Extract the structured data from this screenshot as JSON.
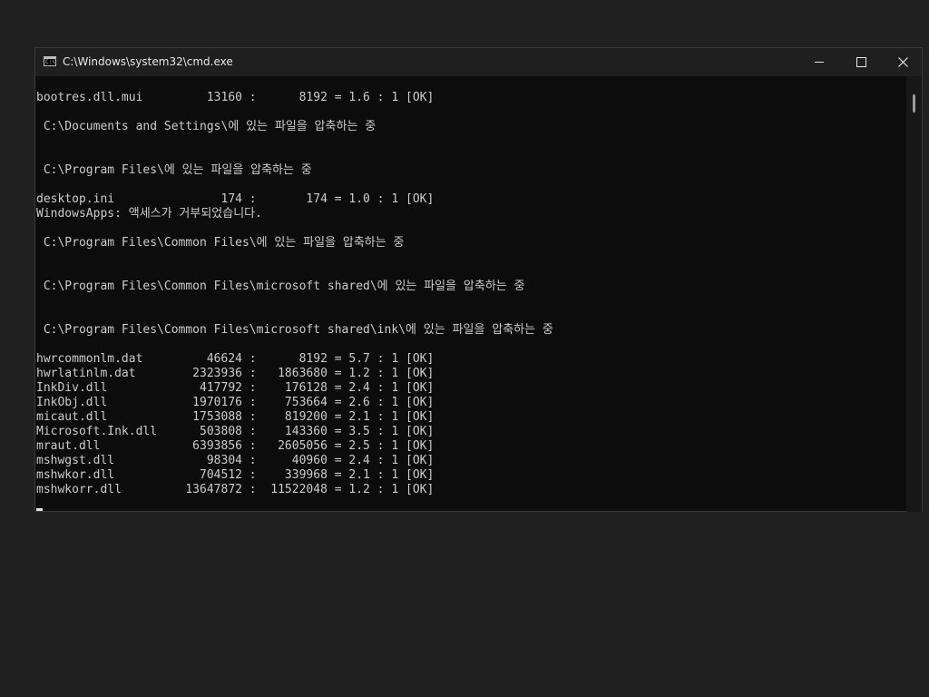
{
  "window": {
    "title": "C:\\Windows\\system32\\cmd.exe",
    "icon": "cmd-icon",
    "icon_text": "C:\\"
  },
  "console": {
    "lines": [
      {
        "row": 0,
        "text": "bootres.dll.mui         13160 :      8192 = 1.6 : 1 [OK]"
      },
      {
        "row": 2,
        "text": " C:\\Documents and Settings\\에 있는 파일을 압축하는 중"
      },
      {
        "row": 5,
        "text": " C:\\Program Files\\에 있는 파일을 압축하는 중"
      },
      {
        "row": 7,
        "text": "desktop.ini               174 :       174 = 1.0 : 1 [OK]"
      },
      {
        "row": 8,
        "text": "WindowsApps: 액세스가 거부되었습니다."
      },
      {
        "row": 10,
        "text": " C:\\Program Files\\Common Files\\에 있는 파일을 압축하는 중"
      },
      {
        "row": 13,
        "text": " C:\\Program Files\\Common Files\\microsoft shared\\에 있는 파일을 압축하는 중"
      },
      {
        "row": 16,
        "text": " C:\\Program Files\\Common Files\\microsoft shared\\ink\\에 있는 파일을 압축하는 중"
      },
      {
        "row": 18,
        "text": "hwrcommonlm.dat         46624 :      8192 = 5.7 : 1 [OK]"
      },
      {
        "row": 19,
        "text": "hwrlatinlm.dat        2323936 :   1863680 = 1.2 : 1 [OK]"
      },
      {
        "row": 20,
        "text": "InkDiv.dll             417792 :    176128 = 2.4 : 1 [OK]"
      },
      {
        "row": 21,
        "text": "InkObj.dll            1970176 :    753664 = 2.6 : 1 [OK]"
      },
      {
        "row": 22,
        "text": "micaut.dll            1753088 :    819200 = 2.1 : 1 [OK]"
      },
      {
        "row": 23,
        "text": "Microsoft.Ink.dll      503808 :    143360 = 3.5 : 1 [OK]"
      },
      {
        "row": 24,
        "text": "mraut.dll             6393856 :   2605056 = 2.5 : 1 [OK]"
      },
      {
        "row": 25,
        "text": "mshwgst.dll             98304 :     40960 = 2.4 : 1 [OK]"
      },
      {
        "row": 26,
        "text": "mshwkor.dll            704512 :    339968 = 2.1 : 1 [OK]"
      },
      {
        "row": 27,
        "text": "mshwkorr.dll         13647872 :  11522048 = 1.2 : 1 [OK]"
      }
    ]
  }
}
